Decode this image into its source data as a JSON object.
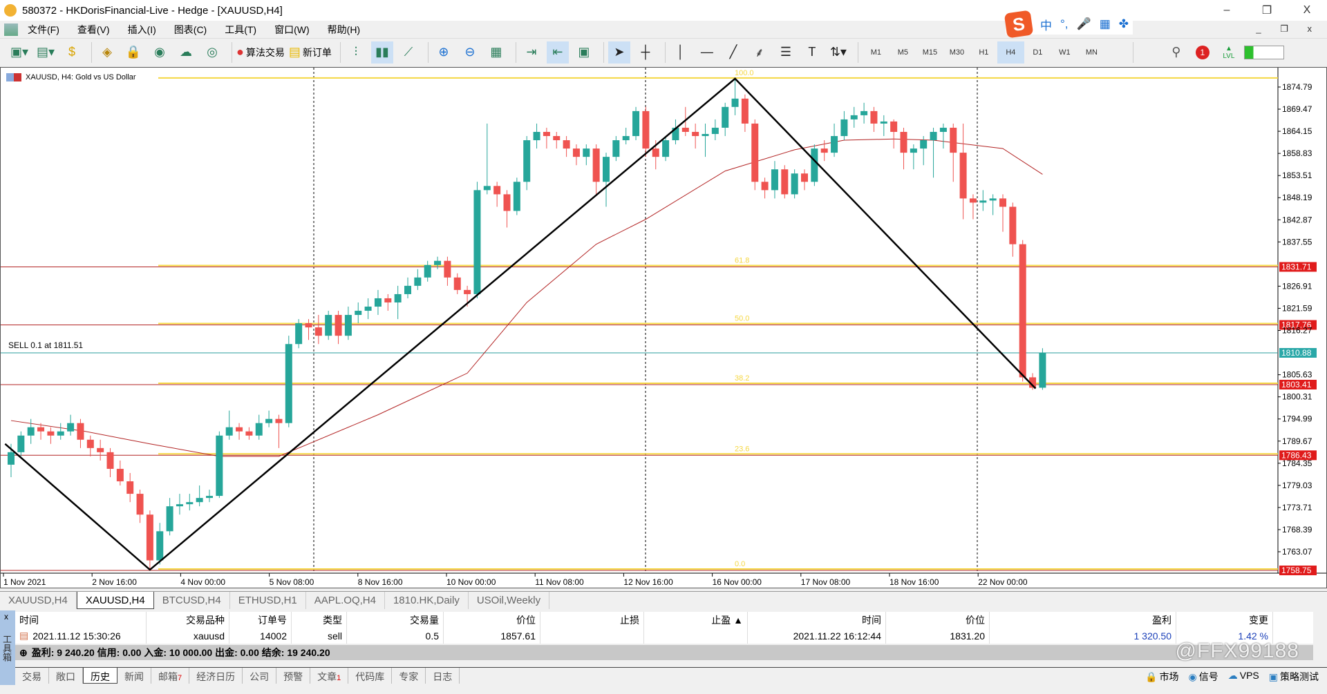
{
  "window": {
    "title": "580372 - HKDorisFinancial-Live - Hedge - [XAUUSD,H4]",
    "minimize": "–",
    "restore": "❐",
    "close": "X"
  },
  "menu": [
    "文件(F)",
    "查看(V)",
    "插入(I)",
    "图表(C)",
    "工具(T)",
    "窗口(W)",
    "帮助(H)"
  ],
  "ime": {
    "logo": "S",
    "lang": "中",
    "punct": "°,",
    "mic": "🎤",
    "kbd": "▦",
    "more": "✤"
  },
  "mdi_controls": "_ ❐ x",
  "toolbar": {
    "algo_trading": "算法交易",
    "new_order": "新订单",
    "timeframes": [
      "M1",
      "M5",
      "M15",
      "M30",
      "H1",
      "H4",
      "D1",
      "W1",
      "MN"
    ],
    "active_timeframe": "H4",
    "notification_count": "1",
    "lvl": "LVL"
  },
  "chart": {
    "symbol_label": "XAUUSD, H4:  Gold vs US Dollar",
    "sell_label": "SELL 0.1 at 1811.51",
    "colors": {
      "bull": "#26a69a",
      "bear": "#ef5350",
      "ma": "#b22222",
      "fib": "#f5d742",
      "level": "#b22222",
      "sell": "#2a9d9d"
    }
  },
  "chart_data": {
    "type": "candlestick",
    "symbol": "XAUUSD",
    "timeframe": "H4",
    "ylim": [
      1756.5,
      1878.9
    ],
    "price_ticks": [
      1874.79,
      1869.47,
      1864.15,
      1858.83,
      1853.51,
      1848.19,
      1842.87,
      1837.55,
      1826.91,
      1821.59,
      1816.27,
      1805.63,
      1800.31,
      1794.99,
      1789.67,
      1784.35,
      1779.03,
      1773.71,
      1768.39,
      1763.07
    ],
    "price_ticks_text": [
      "1874.79",
      "1869.47",
      "1864.15",
      "1858.83",
      "1853.51",
      "1848.19",
      "1842.87",
      "1837.55",
      "1826.91",
      "1821.59",
      "1816.27",
      "1805.63",
      "1800.31",
      "1794.99",
      "1789.67",
      "1784.35",
      "1779.03",
      "1773.71",
      "1768.39",
      "1763.07"
    ],
    "time_labels": [
      "1 Nov 2021",
      "2 Nov 16:00",
      "4 Nov 00:00",
      "5 Nov 08:00",
      "8 Nov 16:00",
      "10 Nov 00:00",
      "11 Nov 08:00",
      "12 Nov 16:00",
      "16 Nov 00:00",
      "17 Nov 08:00",
      "18 Nov 16:00",
      "22 Nov 00:00"
    ],
    "fib_levels": [
      {
        "label": "100.0",
        "price": 1876.8
      },
      {
        "label": "61.8",
        "price": 1831.71,
        "price_text": "1831.71"
      },
      {
        "label": "50.0",
        "price": 1817.76,
        "price_text": "1817.76"
      },
      {
        "label": "38.2",
        "price": 1803.41,
        "price_text": "1803.41"
      },
      {
        "label": "23.6",
        "price": 1786.43,
        "price_text": "1786.43"
      },
      {
        "label": "0.0",
        "price": 1758.75,
        "price_text": "1758.75"
      }
    ],
    "sell_line": {
      "price": 1810.88,
      "price_text": "1810.88"
    },
    "zigzag": [
      [
        -0.6,
        1789.0
      ],
      [
        14,
        1758.75
      ],
      [
        73,
        1876.8
      ],
      [
        103.3,
        1802.3
      ]
    ],
    "ma": [
      [
        0,
        1794.6
      ],
      [
        7.5,
        1792
      ],
      [
        14,
        1789
      ],
      [
        21,
        1786
      ],
      [
        27,
        1786
      ],
      [
        30,
        1789
      ],
      [
        37,
        1796
      ],
      [
        46,
        1806
      ],
      [
        52,
        1823
      ],
      [
        59,
        1837
      ],
      [
        64,
        1843
      ],
      [
        72,
        1854.6
      ],
      [
        79,
        1859.7
      ],
      [
        84,
        1862
      ],
      [
        89,
        1862.3
      ],
      [
        93,
        1862
      ],
      [
        100,
        1860
      ],
      [
        104,
        1853.8
      ]
    ],
    "ohlc": [
      [
        1784,
        1789,
        1781,
        1787
      ],
      [
        1787,
        1792,
        1786,
        1791
      ],
      [
        1791,
        1795,
        1789,
        1793
      ],
      [
        1793,
        1794,
        1790,
        1792
      ],
      [
        1792,
        1793,
        1789,
        1791
      ],
      [
        1791,
        1794,
        1790,
        1792
      ],
      [
        1792,
        1796,
        1791,
        1794
      ],
      [
        1794,
        1795,
        1788,
        1790
      ],
      [
        1790,
        1791,
        1786,
        1788
      ],
      [
        1788,
        1790,
        1785,
        1787
      ],
      [
        1787,
        1788,
        1781,
        1783
      ],
      [
        1783,
        1785,
        1779,
        1780
      ],
      [
        1780,
        1782,
        1775,
        1777
      ],
      [
        1777,
        1778,
        1770,
        1772
      ],
      [
        1772,
        1773,
        1758.75,
        1761
      ],
      [
        1761,
        1770,
        1760,
        1768
      ],
      [
        1768,
        1776,
        1767,
        1774
      ],
      [
        1774,
        1777,
        1772,
        1774.5
      ],
      [
        1774.5,
        1777,
        1773,
        1775
      ],
      [
        1775,
        1779,
        1774,
        1776
      ],
      [
        1776,
        1778,
        1775,
        1776.5
      ],
      [
        1776.5,
        1792,
        1776,
        1791
      ],
      [
        1791,
        1797,
        1790,
        1793
      ],
      [
        1793,
        1794,
        1790,
        1792
      ],
      [
        1792,
        1793,
        1790,
        1791
      ],
      [
        1791,
        1796,
        1790,
        1794
      ],
      [
        1794,
        1797,
        1793,
        1795
      ],
      [
        1795,
        1796,
        1788,
        1794
      ],
      [
        1794,
        1815,
        1793,
        1813
      ],
      [
        1813,
        1819,
        1812,
        1818
      ],
      [
        1818,
        1819,
        1814,
        1817
      ],
      [
        1817,
        1820,
        1813,
        1815
      ],
      [
        1815,
        1821,
        1814,
        1820
      ],
      [
        1820,
        1821,
        1813,
        1815
      ],
      [
        1815,
        1822,
        1814,
        1820
      ],
      [
        1820,
        1823,
        1818,
        1821
      ],
      [
        1821,
        1824,
        1819,
        1822
      ],
      [
        1822,
        1826,
        1820,
        1824
      ],
      [
        1824,
        1825,
        1821,
        1823
      ],
      [
        1823,
        1827,
        1819,
        1825
      ],
      [
        1825,
        1829,
        1824,
        1827
      ],
      [
        1827,
        1831,
        1826,
        1829
      ],
      [
        1829,
        1833,
        1828,
        1832
      ],
      [
        1832,
        1834,
        1831,
        1833
      ],
      [
        1833,
        1834,
        1827,
        1829
      ],
      [
        1829,
        1830,
        1825,
        1826
      ],
      [
        1826,
        1827,
        1822,
        1825
      ],
      [
        1825,
        1852,
        1824,
        1850
      ],
      [
        1850,
        1866,
        1849,
        1851
      ],
      [
        1851,
        1852,
        1846,
        1849
      ],
      [
        1849,
        1850,
        1841,
        1845
      ],
      [
        1845,
        1853,
        1844,
        1852
      ],
      [
        1852,
        1863,
        1850,
        1862
      ],
      [
        1862,
        1866,
        1860,
        1864
      ],
      [
        1864,
        1865,
        1860,
        1863
      ],
      [
        1863,
        1864,
        1860,
        1862
      ],
      [
        1862,
        1863,
        1858,
        1860
      ],
      [
        1860,
        1861,
        1856,
        1858
      ],
      [
        1858,
        1861,
        1856,
        1860
      ],
      [
        1860,
        1861,
        1849,
        1852
      ],
      [
        1852,
        1859,
        1846,
        1858
      ],
      [
        1858,
        1863,
        1857,
        1862
      ],
      [
        1862,
        1865,
        1861,
        1863
      ],
      [
        1863,
        1870,
        1862,
        1869
      ],
      [
        1869,
        1870,
        1858,
        1860
      ],
      [
        1860,
        1862,
        1855,
        1858
      ],
      [
        1858,
        1863,
        1857,
        1862
      ],
      [
        1862,
        1867,
        1861,
        1865
      ],
      [
        1865,
        1870,
        1863,
        1864
      ],
      [
        1864,
        1866,
        1860,
        1863
      ],
      [
        1863,
        1866,
        1858,
        1863.5
      ],
      [
        1863.5,
        1867,
        1862,
        1865
      ],
      [
        1865,
        1871,
        1863,
        1870
      ],
      [
        1870,
        1876.8,
        1868,
        1872
      ],
      [
        1872,
        1873,
        1864,
        1866
      ],
      [
        1866,
        1867,
        1850,
        1852
      ],
      [
        1852,
        1853,
        1848,
        1850
      ],
      [
        1850,
        1857,
        1848,
        1855
      ],
      [
        1855,
        1856,
        1848,
        1849
      ],
      [
        1849,
        1855,
        1848,
        1854
      ],
      [
        1854,
        1855,
        1850,
        1852
      ],
      [
        1852,
        1861,
        1851,
        1860
      ],
      [
        1860,
        1862,
        1857,
        1859
      ],
      [
        1859,
        1866,
        1858,
        1863
      ],
      [
        1863,
        1869,
        1862,
        1867
      ],
      [
        1867,
        1870,
        1865,
        1868
      ],
      [
        1868,
        1871,
        1866,
        1869
      ],
      [
        1869,
        1870,
        1864,
        1866
      ],
      [
        1866,
        1868,
        1863,
        1866.5
      ],
      [
        1866.5,
        1867,
        1860,
        1864
      ],
      [
        1864,
        1865,
        1855,
        1859
      ],
      [
        1859,
        1861,
        1855,
        1860
      ],
      [
        1860,
        1863,
        1856,
        1862
      ],
      [
        1862,
        1865,
        1853,
        1864
      ],
      [
        1864,
        1866,
        1860,
        1865
      ],
      [
        1865,
        1866,
        1852,
        1859
      ],
      [
        1859,
        1866,
        1843,
        1848
      ],
      [
        1848,
        1849,
        1843,
        1847
      ],
      [
        1847,
        1850,
        1845,
        1847.5
      ],
      [
        1847.5,
        1849,
        1844,
        1848
      ],
      [
        1848,
        1849,
        1840,
        1846
      ],
      [
        1846,
        1847,
        1834,
        1837
      ],
      [
        1837,
        1838,
        1804,
        1805
      ],
      [
        1805,
        1806,
        1802,
        1802.5
      ],
      [
        1802.5,
        1812,
        1802,
        1810.88
      ]
    ]
  },
  "chart_tabs": [
    "XAUUSD,H4",
    "XAUUSD,H4",
    "BTCUSD,H4",
    "ETHUSD,H1",
    "AAPL.OQ,H4",
    "1810.HK,Daily",
    "USOil,Weekly"
  ],
  "active_chart_tab": 1,
  "terminal": {
    "side_label": "工具箱",
    "close": "x",
    "headers": [
      "时间",
      "交易品种",
      "订单号",
      "类型",
      "交易量",
      "价位",
      "止损",
      "止盈 ▲",
      "时间",
      "价位",
      "盈利",
      "变更"
    ],
    "row": [
      "2021.11.12 15:30:26",
      "xauusd",
      "14002",
      "sell",
      "0.5",
      "1857.61",
      "",
      "",
      "2021.11.22 16:12:44",
      "1831.20",
      "1 320.50",
      "1.42 %"
    ],
    "summary": "盈利: 9 240.20  信用: 0.00  入金: 10 000.00  出金: 0.00  结余: 19 240.20",
    "tabs": [
      {
        "label": "交易"
      },
      {
        "label": "敞口"
      },
      {
        "label": "历史"
      },
      {
        "label": "新闻"
      },
      {
        "label": "邮箱",
        "badge": "7"
      },
      {
        "label": "经济日历"
      },
      {
        "label": "公司"
      },
      {
        "label": "预警"
      },
      {
        "label": "文章",
        "badge": "1"
      },
      {
        "label": "代码库"
      },
      {
        "label": "专家"
      },
      {
        "label": "日志"
      }
    ],
    "active_tab": 2,
    "links": [
      "市场",
      "信号",
      "VPS",
      "策略测试"
    ],
    "watermark": "@FFX99188"
  }
}
